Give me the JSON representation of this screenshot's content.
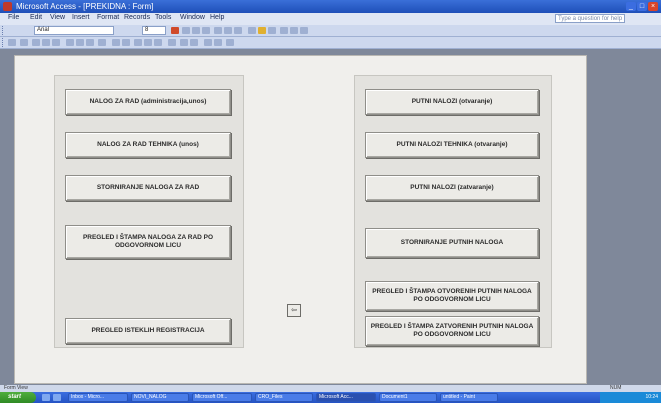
{
  "window": {
    "title": "Microsoft Access - [PREKIDNA : Form]",
    "help_placeholder": "Type a question for help"
  },
  "menu": [
    "File",
    "Edit",
    "View",
    "Insert",
    "Format",
    "Records",
    "Tools",
    "Window",
    "Help"
  ],
  "toolbar": {
    "font": "Arial",
    "size": "8"
  },
  "form": {
    "left_buttons": [
      "NALOG ZA RAD (administracija,unos)",
      "NALOG ZA RAD TEHNIKA (unos)",
      "STORNIRANJE NALOGA ZA RAD",
      "PREGLED I ŠTAMPA NALOGA ZA RAD PO ODGOVORNOM LICU",
      "PREGLED ISTEKLIH REGISTRACIJA"
    ],
    "right_buttons": [
      "PUTNI NALOZI (otvaranje)",
      "PUTNI NALOZI TEHNIKA (otvaranje)",
      "PUTNI NALOZI (zatvaranje)",
      "STORNIRANJE PUTNIH NALOGA",
      "PREGLED I ŠTAMPA OTVORENIH PUTNIH NALOGA PO ODGOVORNOM LICU",
      "PREGLED I ŠTAMPA ZATVORENIH PUTNIH NALOGA PO ODGOVORNOM LICU"
    ],
    "exit_icon": "exit-door-icon"
  },
  "status": {
    "left": "Form View",
    "right": "NUM"
  },
  "taskbar": {
    "start": "start",
    "tasks": [
      "Inbox - Micro...",
      "NOVI_NALOG",
      "Microsoft Off...",
      "CRO_Files",
      "Microsoft Acc...",
      "Document1",
      "untitled - Paint"
    ],
    "clock": "10:24"
  }
}
